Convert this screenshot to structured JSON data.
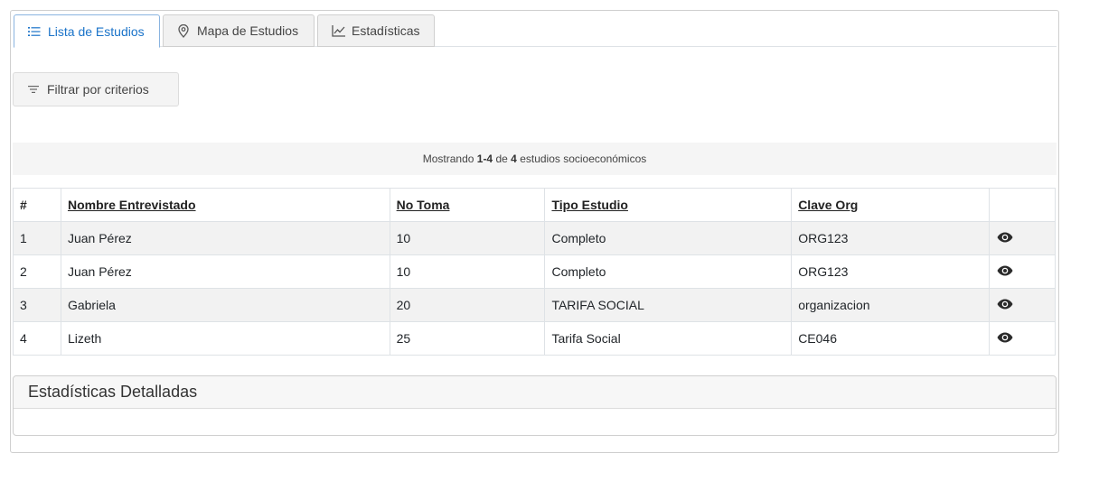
{
  "tabs": [
    {
      "label": "Lista de Estudios",
      "icon": "list-icon",
      "active": true
    },
    {
      "label": "Mapa de Estudios",
      "icon": "map-pin-icon",
      "active": false
    },
    {
      "label": "Estadísticas",
      "icon": "line-chart-icon",
      "active": false
    }
  ],
  "filter": {
    "label": "Filtrar por criterios",
    "icon": "filter-icon"
  },
  "summary": {
    "prefix": "Mostrando",
    "range": "1-4",
    "middle": "de",
    "total": "4",
    "suffix": "estudios socioeconómicos"
  },
  "table": {
    "headers": [
      "#",
      "Nombre Entrevistado",
      "No Toma",
      "Tipo Estudio",
      "Clave Org",
      ""
    ],
    "rows": [
      {
        "num": "1",
        "name": "Juan Pérez",
        "toma": "10",
        "tipo": "Completo",
        "clave": "ORG123"
      },
      {
        "num": "2",
        "name": "Juan Pérez",
        "toma": "10",
        "tipo": "Completo",
        "clave": "ORG123"
      },
      {
        "num": "3",
        "name": "Gabriela",
        "toma": "20",
        "tipo": "TARIFA SOCIAL",
        "clave": "organizacion"
      },
      {
        "num": "4",
        "name": "Lizeth",
        "toma": "25",
        "tipo": "Tarifa Social",
        "clave": "CE046"
      }
    ],
    "action_icon": "eye-icon"
  },
  "stats_card": {
    "title": "Estadísticas Detalladas"
  },
  "colors": {
    "active_tab": "#1a73c9",
    "stripe": "#f2f2f2",
    "border": "#dee2e6"
  }
}
